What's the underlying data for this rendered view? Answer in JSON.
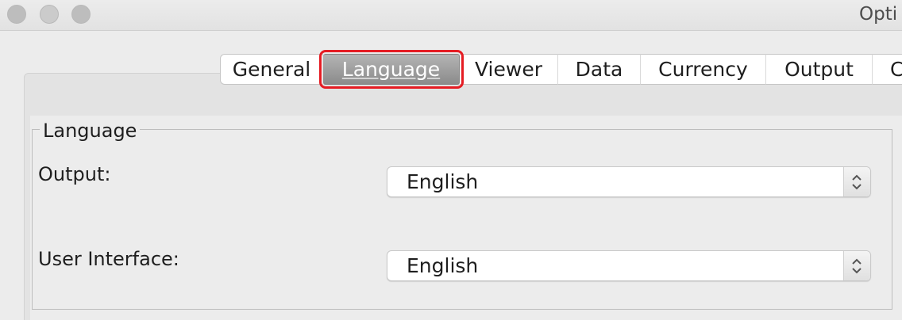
{
  "window": {
    "title": "Opti"
  },
  "tabs": [
    {
      "label": "General",
      "selected": false
    },
    {
      "label": "Language",
      "selected": true
    },
    {
      "label": "Viewer",
      "selected": false
    },
    {
      "label": "Data",
      "selected": false
    },
    {
      "label": "Currency",
      "selected": false
    },
    {
      "label": "Output",
      "selected": false
    },
    {
      "label": "C",
      "selected": false
    }
  ],
  "language_group": {
    "title": "Language",
    "output_label": "Output:",
    "output_value": "English",
    "ui_label": "User Interface:",
    "ui_value": "English"
  },
  "icons": {
    "close": "close-icon",
    "minimize": "minimize-icon",
    "zoom": "zoom-icon",
    "select_arrows": "updown-chevron-icon"
  },
  "colors": {
    "highlight": "#e51c23",
    "selected_tab": "#9a9a9a"
  }
}
